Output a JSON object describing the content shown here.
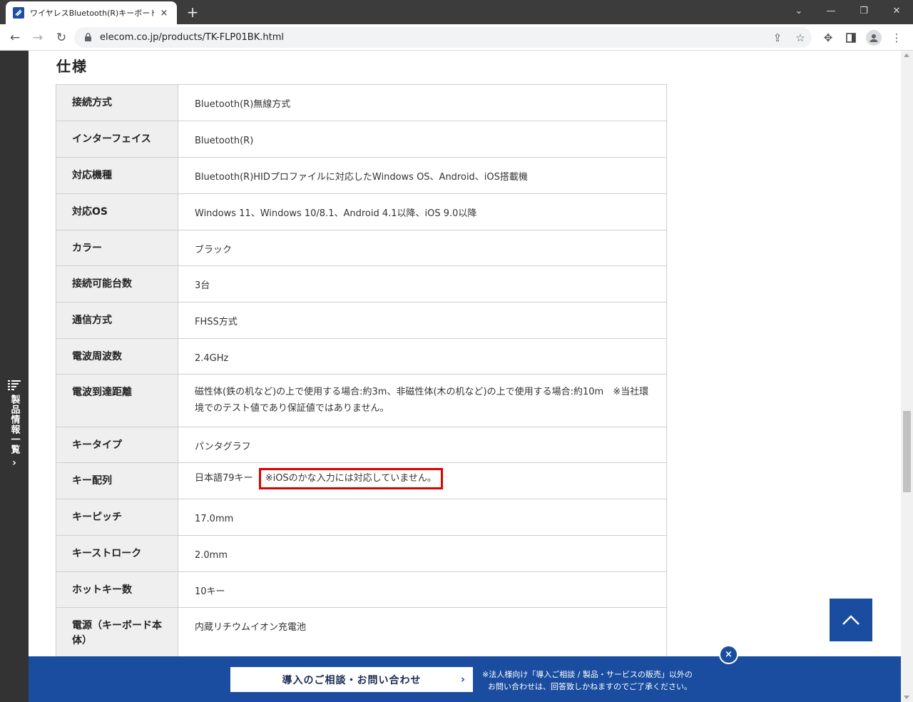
{
  "browser": {
    "tab_title": "ワイヤレスBluetooth(R)キーボード - TK",
    "tab_close": "×",
    "new_tab": "+",
    "url": "elecom.co.jp/products/TK-FLP01BK.html",
    "window_controls": {
      "minimize": "—",
      "restore": "❐",
      "close": "✕",
      "chevron": "⌄"
    }
  },
  "sidebar": {
    "label": "製品情報一覧",
    "chevron": "›"
  },
  "section": {
    "title": "仕様"
  },
  "specs": [
    {
      "key": "接続方式",
      "value": "Bluetooth(R)無線方式"
    },
    {
      "key": "インターフェイス",
      "value": "Bluetooth(R)"
    },
    {
      "key": "対応機種",
      "value": "Bluetooth(R)HIDプロファイルに対応したWindows OS、Android、iOS搭載機"
    },
    {
      "key": "対応OS",
      "value": "Windows 11、Windows 10/8.1、Android 4.1以降、iOS 9.0以降"
    },
    {
      "key": "カラー",
      "value": "ブラック"
    },
    {
      "key": "接続可能台数",
      "value": "3台"
    },
    {
      "key": "通信方式",
      "value": "FHSS方式"
    },
    {
      "key": "電波周波数",
      "value": "2.4GHz"
    },
    {
      "key": "電波到達距離",
      "value": "磁性体(鉄の机など)の上で使用する場合:約3m、非磁性体(木の机など)の上で使用する場合:約10m　※当社環境でのテスト値であり保証値ではありません。"
    },
    {
      "key": "キータイプ",
      "value": "パンタグラフ"
    },
    {
      "key": "キー配列",
      "value": "日本語79キー",
      "note": "※iOSのかな入力には対応していません。"
    },
    {
      "key": "キーピッチ",
      "value": "17.0mm"
    },
    {
      "key": "キーストローク",
      "value": "2.0mm"
    },
    {
      "key": "ホットキー数",
      "value": "10キー"
    },
    {
      "key": "電源（キーボード本体）",
      "value": "内蔵リチウムイオン充電池"
    }
  ],
  "bottom_bar": {
    "contact_label": "導入のご相談・お問い合わせ",
    "contact_chevron": "›",
    "note_line1": "※法人様向け「導入ご相談 / 製品・サービスの販売」以外の",
    "note_line2": "お問い合わせは、回答致しかねますのでご了承ください。",
    "close": "×"
  },
  "colors": {
    "brand_blue": "#1a4da0",
    "highlight_red": "#e00000",
    "sidebar_dark": "#333333"
  }
}
